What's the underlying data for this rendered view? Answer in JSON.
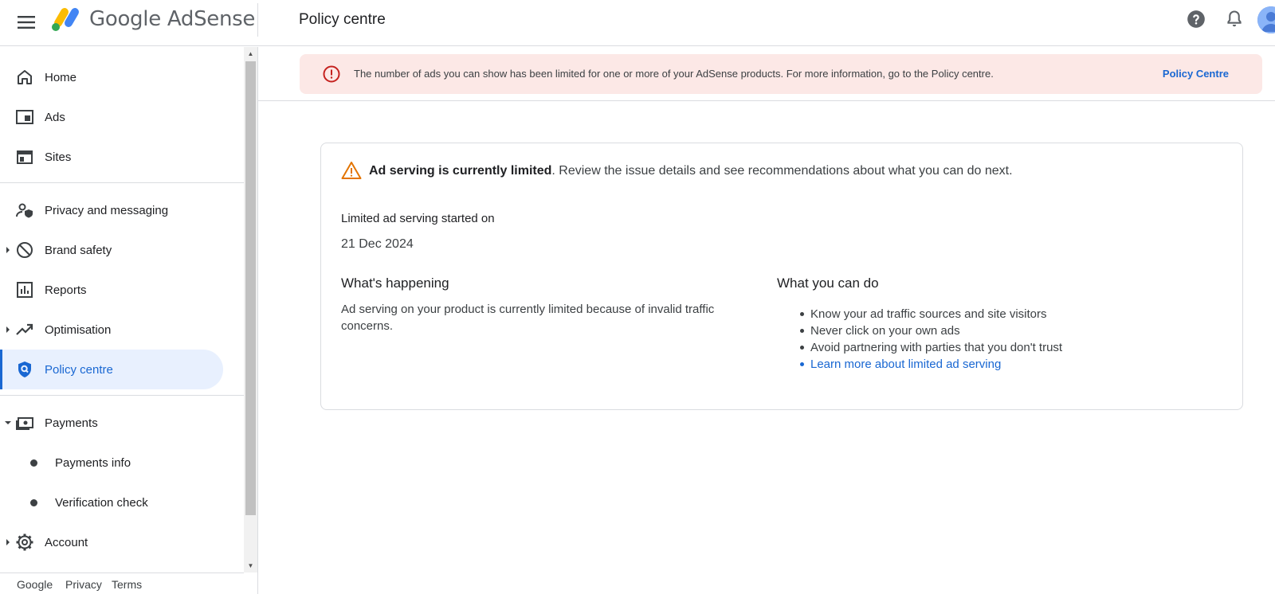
{
  "header": {
    "product_name": "Google AdSense",
    "page_title": "Policy centre"
  },
  "sidebar": {
    "items": [
      {
        "label": "Home",
        "icon": "home-icon"
      },
      {
        "label": "Ads",
        "icon": "ads-icon"
      },
      {
        "label": "Sites",
        "icon": "sites-icon"
      },
      {
        "label": "Privacy and messaging",
        "icon": "privacy-icon"
      },
      {
        "label": "Brand safety",
        "icon": "brand-safety-icon"
      },
      {
        "label": "Reports",
        "icon": "reports-icon"
      },
      {
        "label": "Optimisation",
        "icon": "optimisation-icon"
      },
      {
        "label": "Policy centre",
        "icon": "policy-shield-icon",
        "active": true
      },
      {
        "label": "Payments",
        "icon": "payments-icon"
      },
      {
        "label": "Payments info"
      },
      {
        "label": "Verification check"
      },
      {
        "label": "Account",
        "icon": "gear-icon"
      }
    ],
    "footer": {
      "google": "Google",
      "privacy": "Privacy",
      "terms": "Terms"
    }
  },
  "alert": {
    "text": "The number of ads you can show has been limited for one or more of your AdSense products. For more information, go to the Policy centre.",
    "link": "Policy Centre"
  },
  "card": {
    "headline_bold": "Ad serving is currently limited",
    "headline_rest": ". Review the issue details and see recommendations about what you can do next.",
    "started_label": "Limited ad serving started on",
    "started_date": "21 Dec 2024",
    "happening_title": "What's happening",
    "happening_text": "Ad serving on your product is currently limited because of invalid traffic concerns.",
    "todo_title": "What you can do",
    "todo_items": [
      "Know your ad traffic sources and site visitors",
      "Never click on your own ads",
      "Avoid partnering with parties that you don't trust"
    ],
    "todo_link": "Learn more about limited ad serving"
  },
  "colors": {
    "accent": "#1967d2",
    "active_bg": "#e8f0fe",
    "alert_bg": "#fce8e6",
    "alert_icon": "#c5221f",
    "warning": "#e37400"
  }
}
